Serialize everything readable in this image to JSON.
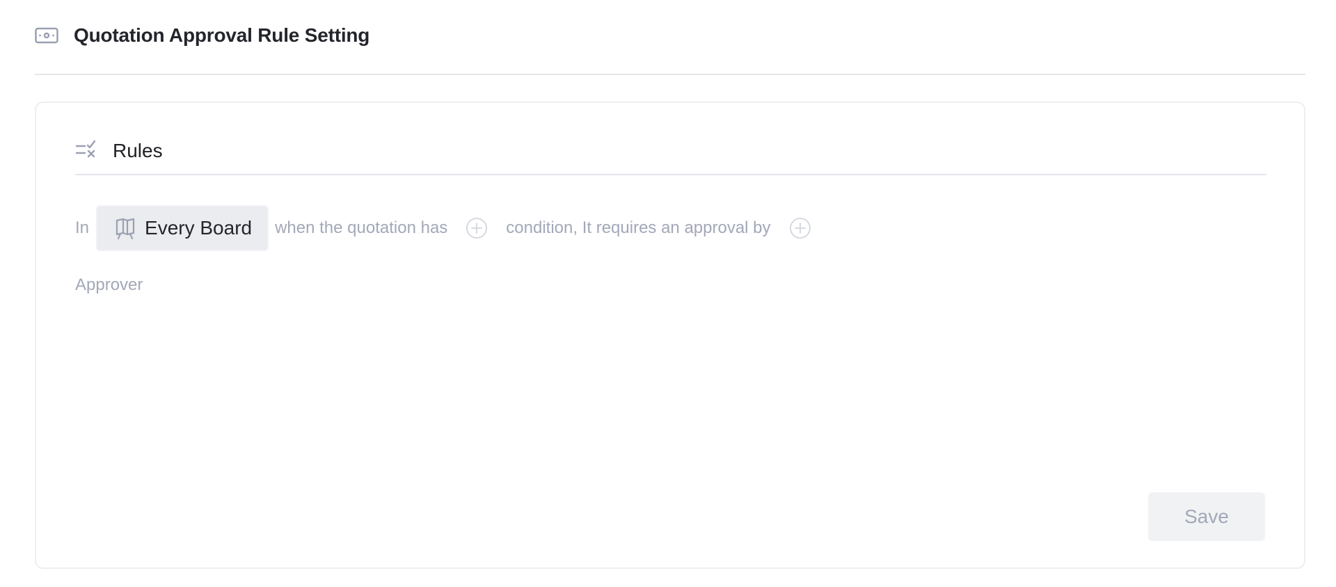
{
  "header": {
    "title": "Quotation Approval Rule Setting",
    "icon": "money-icon"
  },
  "rules": {
    "section_title": "Rules",
    "section_icon": "rules-check-icon",
    "sentence": {
      "prefix": "In",
      "board_scope": "Every Board",
      "board_icon": "board-icon",
      "middle": "when the quotation has",
      "after_condition": "condition, It requires an approval by",
      "add_icon": "plus-circle-icon"
    },
    "approver_label": "Approver",
    "save_label": "Save"
  },
  "colors": {
    "muted_text": "#a3a8b8",
    "chip_bg": "#ebecef",
    "divider": "#e4e6ea",
    "save_bg": "#f1f2f4"
  }
}
